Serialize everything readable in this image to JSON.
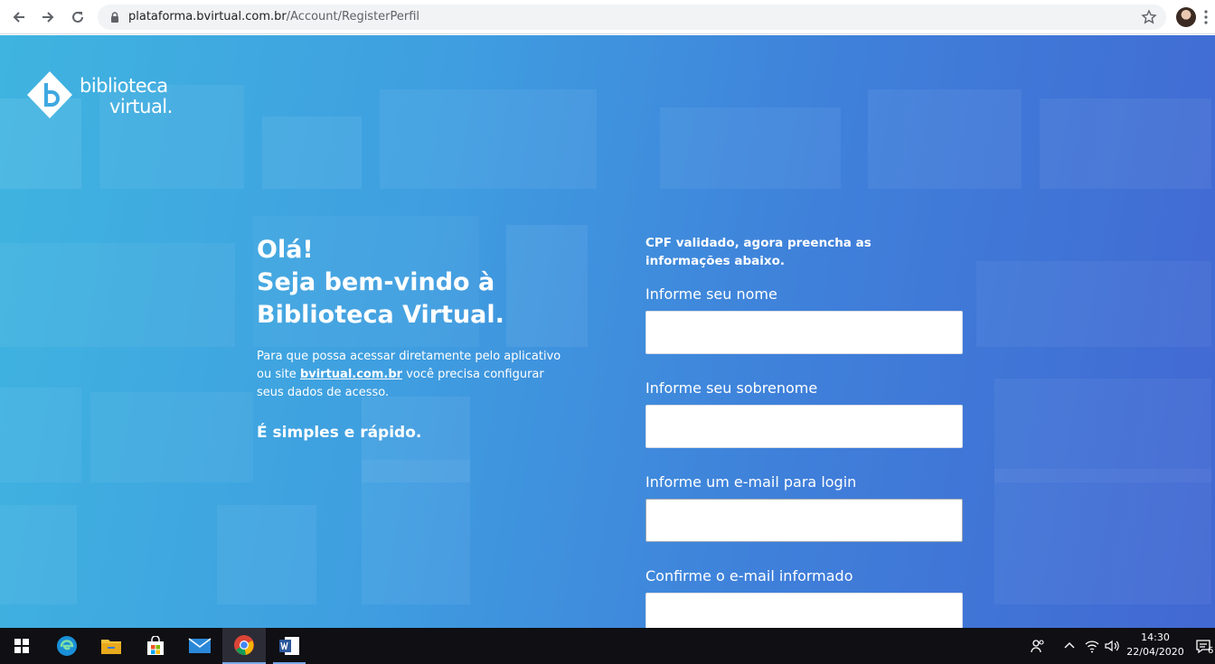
{
  "browser": {
    "url_domain": "plataforma.bvirtual.com.br",
    "url_path": "/Account/RegisterPerfil"
  },
  "logo": {
    "line1": "biblioteca",
    "line2": "virtual."
  },
  "welcome": {
    "greeting": "Olá!",
    "line2": "Seja bem-vindo à",
    "line3": "Biblioteca Virtual.",
    "intro_before": "Para que possa acessar diretamente pelo aplicativo ou site ",
    "intro_link": "bvirtual.com.br",
    "intro_after": " você precisa configurar seus dados de acesso.",
    "tagline": "É simples e rápido."
  },
  "form": {
    "note": "CPF validado, agora preencha as informações abaixo.",
    "fields": [
      {
        "label": "Informe seu nome",
        "value": ""
      },
      {
        "label": "Informe seu sobrenome",
        "value": ""
      },
      {
        "label": "Informe um e-mail para login",
        "value": ""
      },
      {
        "label": "Confirme o e-mail informado",
        "value": ""
      }
    ]
  },
  "taskbar": {
    "time": "14:30",
    "date": "22/04/2020",
    "notification_count": "6",
    "apps": [
      "start-icon",
      "edge-icon",
      "file-explorer-icon",
      "store-icon",
      "mail-icon",
      "chrome-icon",
      "word-icon"
    ]
  },
  "colors": {
    "bg_start": "#3fb4e0",
    "bg_end": "#4268d2"
  }
}
